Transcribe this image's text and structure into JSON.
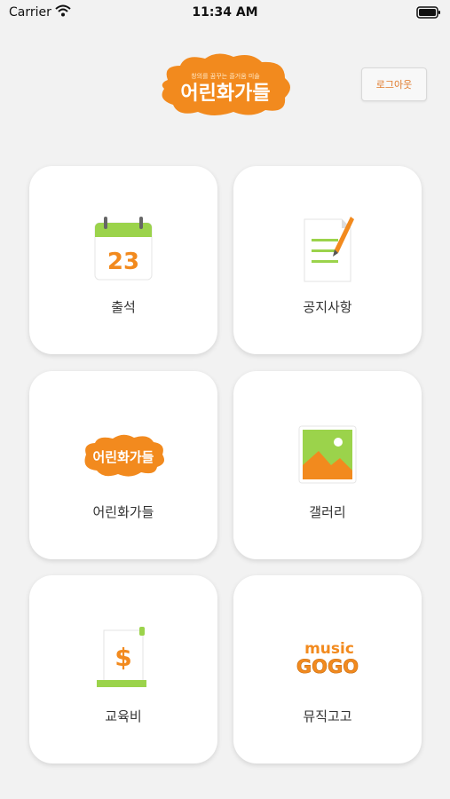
{
  "status": {
    "carrier": "Carrier",
    "time": "11:34 AM"
  },
  "header": {
    "logo_text": "어린화가들",
    "logo_tagline": "창의를 꿈꾸는 즐거움 미술",
    "logout_label": "로그아웃"
  },
  "menu": {
    "items": [
      {
        "label": "출석",
        "icon": "calendar-icon",
        "date": "23"
      },
      {
        "label": "공지사항",
        "icon": "notice-icon"
      },
      {
        "label": "어린화가들",
        "icon": "logo-icon",
        "logo_text": "어린화가들"
      },
      {
        "label": "갤러리",
        "icon": "gallery-icon"
      },
      {
        "label": "교육비",
        "icon": "fee-icon",
        "symbol": "$"
      },
      {
        "label": "뮤직고고",
        "icon": "music-gogo-icon",
        "logo_top": "music",
        "logo_bottom": "GOGO"
      }
    ]
  },
  "colors": {
    "accent": "#f28a1e",
    "green": "#9bd34b",
    "background": "#f2f2f2"
  }
}
